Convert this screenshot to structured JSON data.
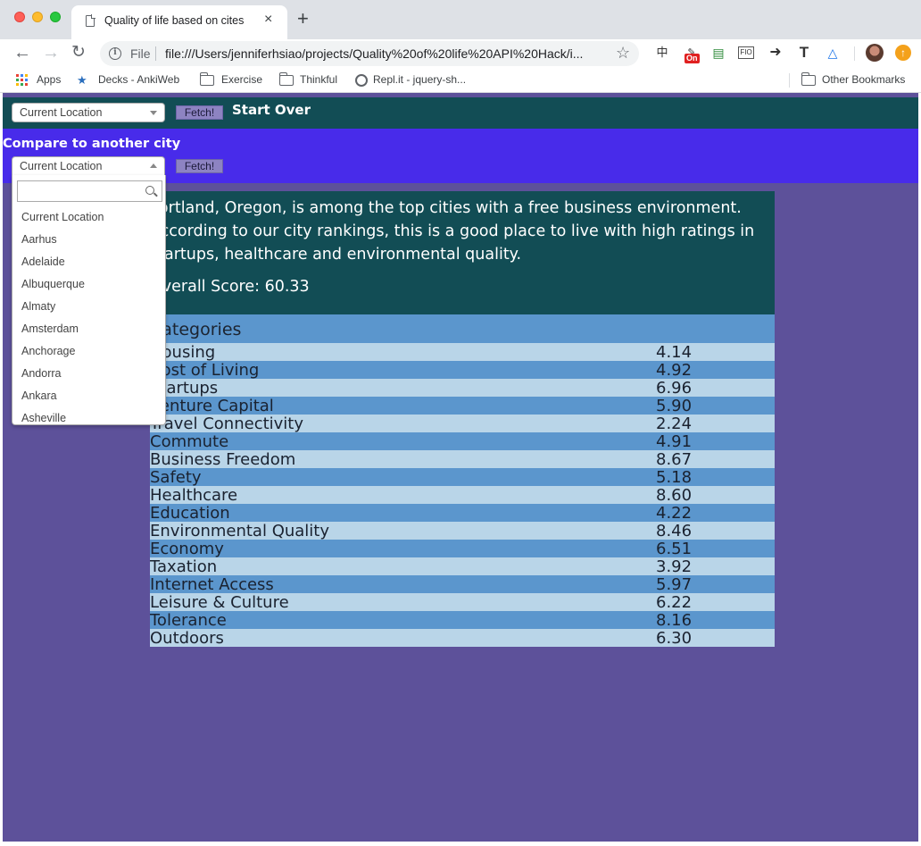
{
  "browser": {
    "tab_title": "Quality of life based on cites",
    "tab_close": "×",
    "new_tab": "+",
    "url_scheme": "File",
    "url": "file:///Users/jenniferhsiao/projects/Quality%20of%20life%20API%20Hack/i...",
    "extension_badge": "On",
    "extension_labels": [
      "中",
      "FIO",
      "T"
    ],
    "bookmarks": [
      {
        "label": "Apps",
        "icon": "apps-grid-icon"
      },
      {
        "label": "Decks - AnkiWeb",
        "icon": "anki-icon"
      },
      {
        "label": "Exercise",
        "icon": "folder-icon"
      },
      {
        "label": "Thinkful",
        "icon": "folder-icon"
      },
      {
        "label": "Repl.it - jquery-sh...",
        "icon": "replit-icon"
      }
    ],
    "other_bookmarks": "Other Bookmarks"
  },
  "header": {
    "select_value": "Current Location",
    "fetch_label": "Fetch!",
    "start_over": "Start Over"
  },
  "compare": {
    "label": "Compare to another city",
    "select_value": "Current Location",
    "fetch_label": "Fetch!",
    "search_placeholder": "",
    "options": [
      "Current Location",
      "Aarhus",
      "Adelaide",
      "Albuquerque",
      "Almaty",
      "Amsterdam",
      "Anchorage",
      "Andorra",
      "Ankara",
      "Asheville"
    ]
  },
  "summary": {
    "text": "Portland, Oregon, is among the top cities with a free business environment. According to our city rankings, this is a good place to live with high ratings in startups, healthcare and environmental quality.",
    "overall": "Overall Score: 60.33"
  },
  "categories": {
    "heading": "Categories",
    "rows": [
      {
        "name": "Housing",
        "value": "4.14"
      },
      {
        "name": "Cost of Living",
        "value": "4.92"
      },
      {
        "name": "Startups",
        "value": "6.96"
      },
      {
        "name": "Venture Capital",
        "value": "5.90"
      },
      {
        "name": "Travel Connectivity",
        "value": "2.24"
      },
      {
        "name": "Commute",
        "value": "4.91"
      },
      {
        "name": "Business Freedom",
        "value": "8.67"
      },
      {
        "name": "Safety",
        "value": "5.18"
      },
      {
        "name": "Healthcare",
        "value": "8.60"
      },
      {
        "name": "Education",
        "value": "4.22"
      },
      {
        "name": "Environmental Quality",
        "value": "8.46"
      },
      {
        "name": "Economy",
        "value": "6.51"
      },
      {
        "name": "Taxation",
        "value": "3.92"
      },
      {
        "name": "Internet Access",
        "value": "5.97"
      },
      {
        "name": "Leisure & Culture",
        "value": "6.22"
      },
      {
        "name": "Tolerance",
        "value": "8.16"
      },
      {
        "name": "Outdoors",
        "value": "6.30"
      }
    ]
  },
  "colors": {
    "header_bar": "#124d55",
    "compare_bar": "#482bea",
    "page_bg": "#5d519a",
    "row_light": "#b9d5e8",
    "row_dark": "#5b96cd"
  }
}
